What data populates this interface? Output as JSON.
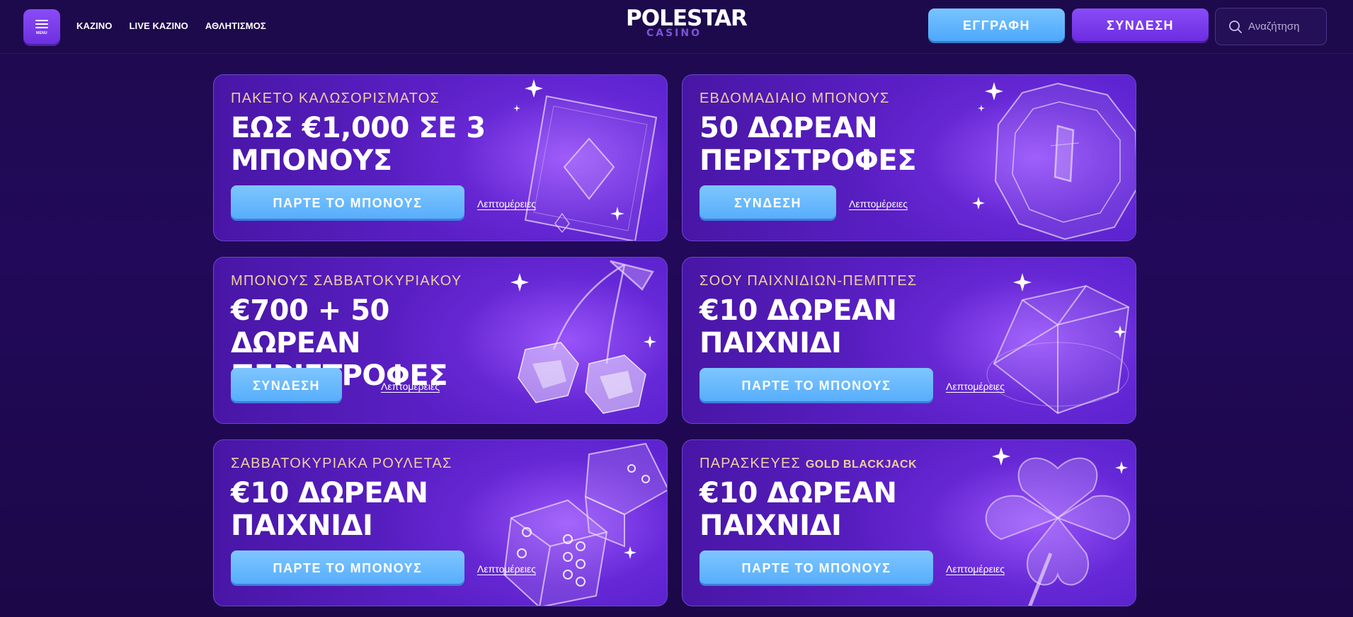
{
  "header": {
    "menu_label": "MENU",
    "nav": [
      "ΚΑΖΙΝΟ",
      "LIVE ΚΑΖΙΝΟ",
      "ΑΘΛΗΤΙΣΜΟΣ"
    ],
    "logo_top": "POLESTAR",
    "logo_bottom": "CASINO",
    "register_label": "ΕΓΓΡΑΦΗ",
    "login_label": "ΣΥΝΔΕΣΗ",
    "search_placeholder": "Αναζήτηση"
  },
  "colors": {
    "page_bg": "#1e0b4e",
    "accent_purple": "#7a3cf0",
    "accent_blue": "#5aaefb",
    "eyebrow_gold": "#f0cfa0"
  },
  "promos": [
    {
      "eyebrow": "ΠΑΚΕΤΟ ΚΑΛΩΣΟΡΙΣΜΑΤΟΣ",
      "headline": "ΕΩΣ €1,000 ΣΕ 3 ΜΠΟΝΟΥΣ",
      "cta": "ΠΑΡΤΕ ΤΟ ΜΠΟΝΟΥΣ",
      "details": "Λεπτομέρειες",
      "art": "card-diamond-icon"
    },
    {
      "eyebrow": "ΕΒΔΟΜΑΔΙΑΙΟ ΜΠΟΝΟΥΣ",
      "headline": "50 ΔΩΡΕΑΝ ΠΕΡΙΣΤΡΟΦΕΣ",
      "cta": "ΣΥΝΔΕΣΗ",
      "details": "Λεπτομέρειες",
      "art": "coin-icon"
    },
    {
      "eyebrow": "ΜΠΟΝΟΥΣ ΣΑΒΒΑΤΟΚΥΡΙΑΚΟΥ",
      "headline": "€700 + 50 ΔΩΡΕΑΝ ΠΕΡΙΣΤΡΟΦΕΣ",
      "cta": "ΣΥΝΔΕΣΗ",
      "details": "Λεπτομέρειες",
      "art": "cherries-icon"
    },
    {
      "eyebrow": "ΣΟΟΥ ΠΑΙΧΝΙΔΙΩΝ-ΠΕΜΠΤΕΣ",
      "headline": "€10 ΔΩΡΕΑΝ ΠΑΙΧΝΙΔΙ",
      "cta": "ΠΑΡΤΕ ΤΟ ΜΠΟΝΟΥΣ",
      "details": "Λεπτομέρειες",
      "art": "gem-icon"
    },
    {
      "eyebrow": "ΣΑΒΒΑΤΟΚΥΡΙΑΚΑ ΡΟΥΛΕΤΑΣ",
      "headline": "€10 ΔΩΡΕΑΝ ΠΑΙΧΝΙΔΙ",
      "cta": "ΠΑΡΤΕ ΤΟ ΜΠΟΝΟΥΣ",
      "details": "Λεπτομέρειες",
      "art": "dice-icon"
    },
    {
      "eyebrow": "ΠΑΡΑΣΚΕΥΕΣ ",
      "eyebrow_brand": "GOLD BLACKJACK",
      "headline": "€10 ΔΩΡΕΑΝ ΠΑΙΧΝΙΔΙ",
      "cta": "ΠΑΡΤΕ ΤΟ ΜΠΟΝΟΥΣ",
      "details": "Λεπτομέρειες",
      "art": "clover-icon"
    }
  ]
}
